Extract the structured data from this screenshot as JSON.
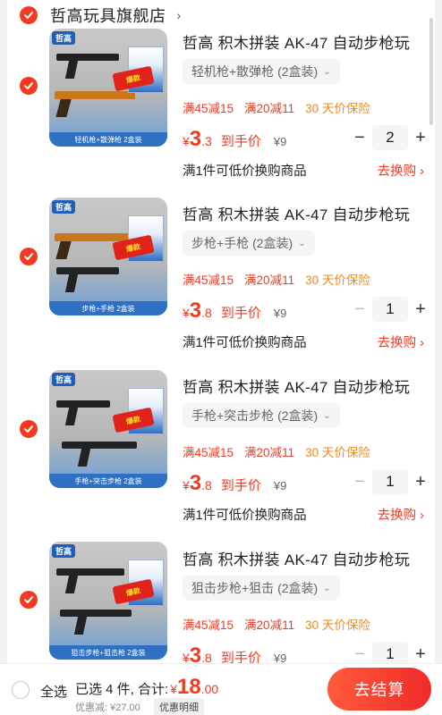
{
  "shop": {
    "name": "哲高玩具旗舰店",
    "chevron": "›"
  },
  "items": [
    {
      "title": "哲高 积木拼装 AK-47 自动步枪玩",
      "sku": "轻机枪+散弹枪 (2盒装)",
      "promo1": "满45减15",
      "promo2": "满20减11",
      "promo3": "30 天价保险",
      "currency": "¥",
      "price_int": "3",
      "price_dec": ".3",
      "price_label": "到手价",
      "orig_price": "¥9",
      "qty": "2",
      "swap_label": "满1件可低价换购商品",
      "swap_link": "去换购 ›",
      "img_caption": "轻机枪+散弹枪  2盒装",
      "brand_tag": "哲高",
      "burst": "爆款"
    },
    {
      "title": "哲高 积木拼装 AK-47 自动步枪玩",
      "sku": "步枪+手枪 (2盒装)",
      "promo1": "满45减15",
      "promo2": "满20减11",
      "promo3": "30 天价保险",
      "currency": "¥",
      "price_int": "3",
      "price_dec": ".8",
      "price_label": "到手价",
      "orig_price": "¥9",
      "qty": "1",
      "swap_label": "满1件可低价换购商品",
      "swap_link": "去换购 ›",
      "img_caption": "步枪+手枪  2盒装",
      "brand_tag": "哲高",
      "burst": "爆款"
    },
    {
      "title": "哲高 积木拼装 AK-47 自动步枪玩",
      "sku": "手枪+突击步枪 (2盒装)",
      "promo1": "满45减15",
      "promo2": "满20减11",
      "promo3": "30 天价保险",
      "currency": "¥",
      "price_int": "3",
      "price_dec": ".8",
      "price_label": "到手价",
      "orig_price": "¥9",
      "qty": "1",
      "swap_label": "满1件可低价换购商品",
      "swap_link": "去换购 ›",
      "img_caption": "手枪+突击步枪  2盒装",
      "brand_tag": "哲高",
      "burst": "爆款"
    },
    {
      "title": "哲高 积木拼装 AK-47 自动步枪玩",
      "sku": "狙击步枪+狙击 (2盒装)",
      "promo1": "满45减15",
      "promo2": "满20减11",
      "promo3": "30 天价保险",
      "currency": "¥",
      "price_int": "3",
      "price_dec": ".8",
      "price_label": "到手价",
      "orig_price": "¥9",
      "qty": "1",
      "swap_label": "",
      "swap_link": "",
      "img_caption": "狙击步枪+狙击枪  2盒装",
      "brand_tag": "哲高",
      "burst": "爆款"
    }
  ],
  "stepper": {
    "minus": "−",
    "plus": "+"
  },
  "footer": {
    "select_all": "全选",
    "selected_text": "已选 4 件, 合计:",
    "currency": "¥",
    "total_int": "18",
    "total_dec": ".00",
    "discount": "优惠减: ¥27.00",
    "discount_detail": "优惠明细",
    "checkout": "去结算"
  },
  "colors": {
    "accent": "#f03a23",
    "insurance": "#f08a1c",
    "checkout_start": "#ff5b3a",
    "checkout_end": "#f02a2a"
  },
  "icons": {
    "check": "check-icon",
    "chevron": "chevron-right-icon",
    "caret": "caret-down-icon"
  }
}
